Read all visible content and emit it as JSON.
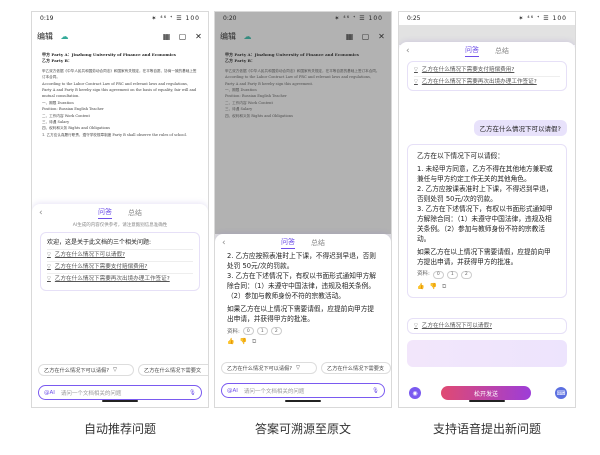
{
  "phone1": {
    "time": "0:19",
    "status_right": "✶ ⁴⁶ ᐩ ☰ 100",
    "toolbar": {
      "title": "编辑"
    },
    "doc": {
      "title": "甲方 Party A：Jinzhong University of Finance and Economics",
      "line2": "乙方 Party B：",
      "paras": [
        "甲乙双方依据《中华人民共和国劳动合同法》和国家有关规定，在平等自愿、协商一致的基础上签订本合同。",
        "According to the Labor Contract Law of PRC and relevant laws and regulations, Party A and Party B hereby sign this agreement on the basis of equality, fair will and mutual consultation.",
        "一、期限 Duration",
        "Position: Russian English Teacher",
        "二、工作内容 Work Content",
        "三、待遇 Salary",
        "四、权利和义务 Rights and Obligations",
        "1. 乙方应认真履行职责，遵守学校规章制度 Party B shall observe the rules of school."
      ]
    },
    "panel": {
      "tabs": [
        "问答",
        "总结"
      ],
      "hint": "AI生成的内容仅供参考，请注意甄别信息准确性",
      "welcome": "欢迎，这是关于此文档的三个相关问题:",
      "suggestions": [
        "乙方在什么情况下可以请假?",
        "乙方在什么情况下需要支付赔偿费用?",
        "乙方在什么情况下需要再次出境办理工作签证?"
      ],
      "chips": [
        "乙方在什么情况下可以请假?",
        "乙方在什么情况下需要文"
      ],
      "input_ai": "@AI",
      "input_placeholder": "请问一个文档相关的问题"
    }
  },
  "phone2": {
    "time": "0:20",
    "status_right": "✶ ⁴⁶ ᐩ ☰ 100",
    "toolbar": {
      "title": "编辑"
    },
    "doc": {
      "title": "甲方 Party A：Jinzhong University of Finance and Economics",
      "line2": "乙方 Party B：",
      "paras": [
        "甲乙双方依据《中华人民共和国劳动合同法》和国家有关规定，在平等自愿的基础上签订本合同。",
        "According to the Labor Contract Law of PRC and relevant laws and regulations, Party A and Party B hereby sign this agreement.",
        "一、期限 Duration",
        "Position: Russian English Teacher",
        "二、工作内容 Work Content",
        "三、待遇 Salary",
        "四、权利和义务 Rights and Obligations"
      ]
    },
    "panel": {
      "tabs": [
        "问答",
        "总结"
      ],
      "answer": [
        "2. 乙方应按照表准时上下课，不得迟到早退，否则处罚 50元/次的罚款。",
        "3. 乙方在下述情况下，有权以书面形式通知甲方解除合同：（1）未遵守中国法律，违规及相关条例。（2）参加与教师身份不符的宗教活动。",
        "如果乙方在以上情况下需要请假，应提前向甲方提出申请，并获得甲方的批准。"
      ],
      "src_label": "资料:",
      "src": [
        "0",
        "1",
        "2"
      ],
      "chips": [
        "乙方在什么情况下可以请假?",
        "乙方在什么情况下需要支"
      ],
      "input_ai": "@AI",
      "input_placeholder": "请问一个文档相关的问题"
    }
  },
  "phone3": {
    "time": "0:25",
    "status_right": "✶ ⁴⁶ ᐩ ☰ 100",
    "panel": {
      "tabs": [
        "问答",
        "总结"
      ],
      "suggestions": [
        "乙方在什么情况下需要支付赔偿费用?",
        "乙方在什么情况下需要再次出境办理工作签证?"
      ],
      "user_q": "乙方在什么情况下可以请假?",
      "answer": [
        "乙方在以下情况下可以请假：",
        "1. 未经甲方同意，乙方不得在其他地方兼职或兼任与甲方约定工作无关的其他角色。",
        "2. 乙方应按课表准时上下课，不得迟到早退，否则处罚 50元/次的罚款。",
        "3. 乙方在下述情况下，有权以书面形式通知甲方解除合同：（1）未遵守中国法律，违规及相关条例。（2）参加与教师身份不符的宗教活动。",
        "如果乙方在以上情况下需要请假，应提前向甲方提出申请，并获得甲方的批准。"
      ],
      "src_label": "资料:",
      "src": [
        "0",
        "1",
        "2"
      ],
      "related": "乙方在什么情况下可以请假?",
      "voice_btn": "松开发送"
    }
  },
  "captions": [
    "自动推荐问题",
    "答案可溯源至原文",
    "支持语音提出新问题"
  ],
  "colors": {
    "accent": "#6d4ee8",
    "voice_btn": "#e04a72"
  }
}
